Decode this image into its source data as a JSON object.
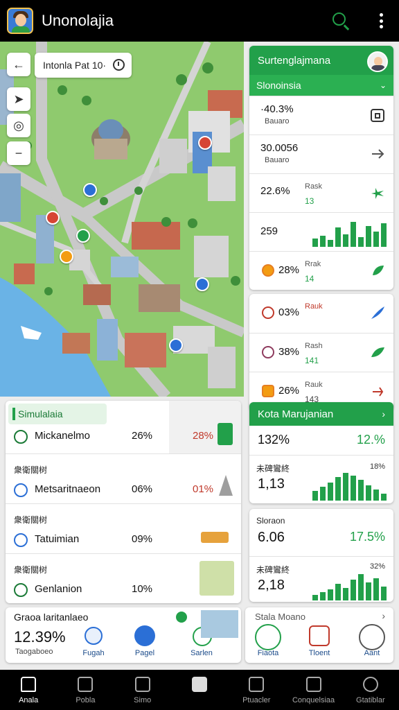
{
  "app": {
    "title": "Unonolajia"
  },
  "map": {
    "search_text": "Intonla Pat 10·"
  },
  "side_card": {
    "title": "Surtenglajmana",
    "subtitle": "Slonoinsia",
    "rows": [
      {
        "value": "·40.3%",
        "label": "Bauaro",
        "icon": "calendar-icon"
      },
      {
        "value": "30.0056",
        "label": "Bauaro",
        "icon": "arrow-right-icon"
      },
      {
        "value": "22.6%",
        "label": "Rask",
        "green": "13",
        "icon": "plane-icon"
      },
      {
        "value": "259",
        "icon": "bar-chart-icon"
      },
      {
        "value": "28%",
        "label": "Rrak",
        "green": "14",
        "icon": "leaf-icon"
      }
    ]
  },
  "side_card2": {
    "rows": [
      {
        "value": "03%",
        "label": "Rauk"
      },
      {
        "value": "38%",
        "label": "Rash",
        "green": "141"
      },
      {
        "value": "26%",
        "label": "Rauk",
        "green": "143"
      }
    ]
  },
  "list_panel": {
    "tab": "Simulalaia",
    "rows": [
      {
        "name": "Mickanelmo",
        "pct": "26%",
        "pct2": "28%"
      },
      {
        "small": "衆衛關树",
        "name": "Metsaritnaeon",
        "pct": "06%",
        "pct2": "01%"
      },
      {
        "small": "衆衛關树",
        "name": "Tatuimian",
        "pct": "09%",
        "pct2": ""
      },
      {
        "small": "衆衛關树",
        "name": "Genlanion",
        "pct": "10%",
        "pct2": ""
      }
    ]
  },
  "metric_card": {
    "title": "Kota Marujanian",
    "rows": [
      {
        "big": "132%",
        "green": "12.%"
      },
      {
        "label": "未碑鸞終",
        "big": "1,13",
        "green": "18%"
      }
    ]
  },
  "metric_card2": {
    "rows": [
      {
        "label": "Sloraon",
        "big": "6.06",
        "green": "17.5%"
      },
      {
        "label": "未碑鸞終",
        "big": "2,18",
        "green": "32%"
      }
    ]
  },
  "quick_left": {
    "title": "Graoa laritanlaeo",
    "value": "12.39%",
    "sub": "Taogaboeo",
    "buttons": [
      "Fugah",
      "Pagel",
      "Sarlen"
    ]
  },
  "quick_right": {
    "title": "Stala Moano",
    "buttons": [
      "Fiaota",
      "Tloent",
      "Aant"
    ]
  },
  "nav": [
    "Anala",
    "Pobla",
    "Simo",
    "",
    "Ptuacler",
    "Conquelsiaa",
    "Gtatiblar"
  ],
  "colors": {
    "accent": "#22a04a",
    "topbar": "#000000"
  }
}
